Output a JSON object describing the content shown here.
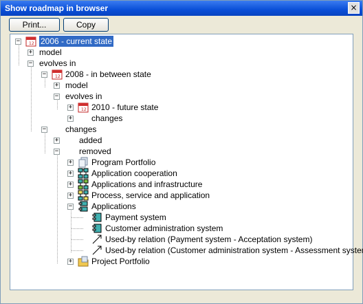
{
  "window": {
    "title": "Show roadmap in browser",
    "close_glyph": "×"
  },
  "toolbar": {
    "print_label": "Print...",
    "copy_label": "Copy"
  },
  "tree": {
    "nodes": [
      {
        "label": "2006 - current state",
        "icon": "calendar-icon",
        "expander": "minus",
        "selected": true
      },
      {
        "label": "model",
        "icon": "none",
        "expander": "plus"
      },
      {
        "label": "evolves in",
        "icon": "none",
        "expander": "minus"
      },
      {
        "label": "2008 - in between state",
        "icon": "calendar-icon",
        "expander": "minus"
      },
      {
        "label": "model",
        "icon": "none",
        "expander": "plus"
      },
      {
        "label": "evolves in",
        "icon": "none",
        "expander": "minus"
      },
      {
        "label": "2010 - future state",
        "icon": "calendar-icon",
        "expander": "plus"
      },
      {
        "label": "changes",
        "icon": "none",
        "expander": "plus"
      },
      {
        "label": "changes",
        "icon": "none",
        "expander": "minus"
      },
      {
        "label": "added",
        "icon": "none",
        "expander": "plus"
      },
      {
        "label": "removed",
        "icon": "none",
        "expander": "minus"
      },
      {
        "label": "Program Portfolio",
        "icon": "program-portfolio-icon",
        "expander": "plus"
      },
      {
        "label": "Application cooperation",
        "icon": "application-cooperation-icon",
        "expander": "plus"
      },
      {
        "label": "Applications and infrastructure",
        "icon": "applications-infrastructure-icon",
        "expander": "plus"
      },
      {
        "label": "Process, service and application",
        "icon": "process-service-icon",
        "expander": "plus"
      },
      {
        "label": "Applications",
        "icon": "applications-icon",
        "expander": "minus"
      },
      {
        "label": "Payment system",
        "icon": "component-icon",
        "expander": "none"
      },
      {
        "label": "Customer administration system",
        "icon": "component-icon",
        "expander": "none"
      },
      {
        "label": "Used-by relation (Payment system - Acceptation system)",
        "icon": "relation-arrow-icon",
        "expander": "none"
      },
      {
        "label": "Used-by relation (Customer administration system - Assessment system)",
        "icon": "relation-arrow-icon",
        "expander": "none"
      },
      {
        "label": "Project Portfolio",
        "icon": "project-portfolio-icon",
        "expander": "plus"
      }
    ]
  },
  "colors": {
    "selection": "#316ac5",
    "titlebar": "#0a4fd8",
    "component": "#40b0b0"
  }
}
